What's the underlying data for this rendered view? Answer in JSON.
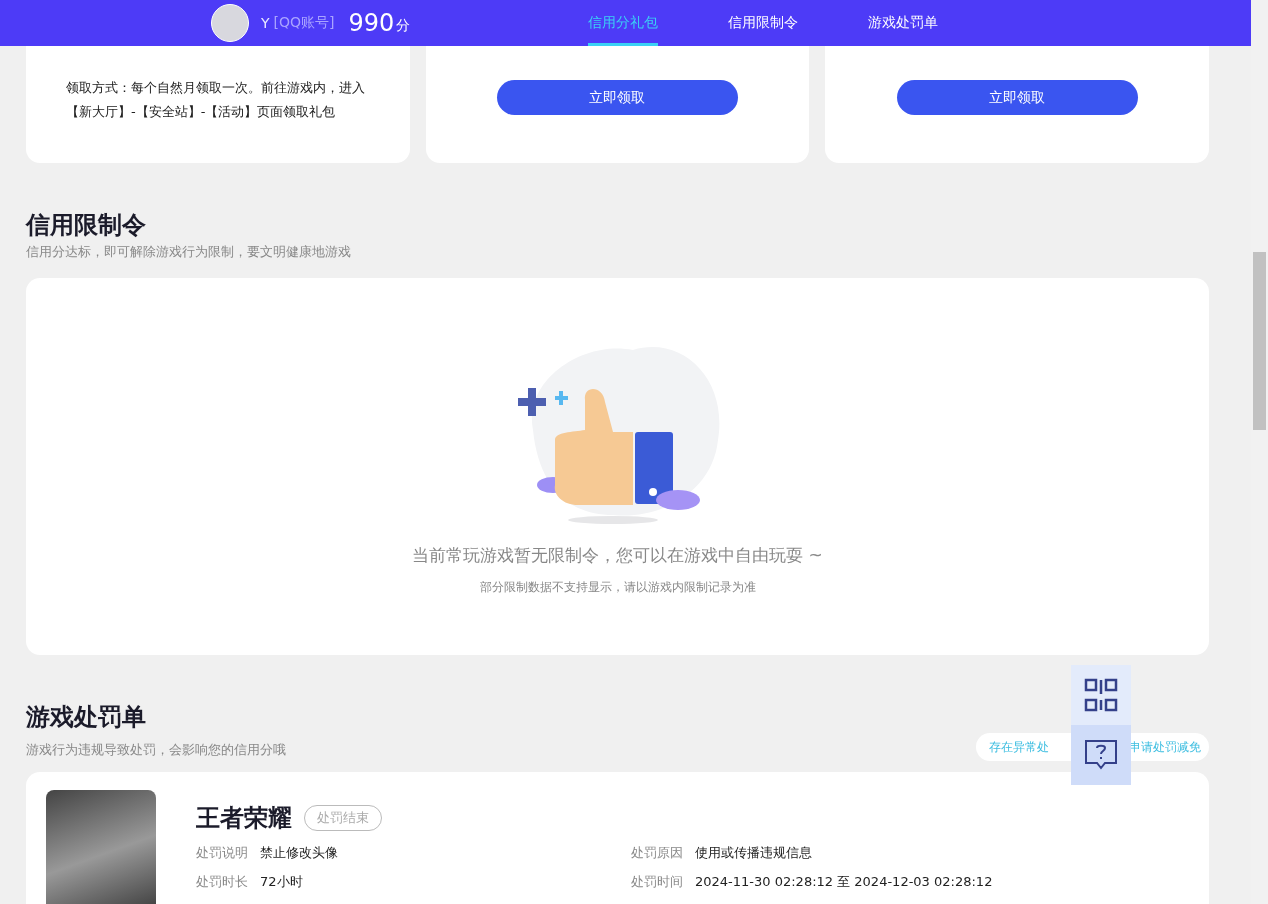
{
  "header": {
    "user_name": "Y",
    "account_type": "[QQ账号]",
    "score": "990",
    "score_unit": "分",
    "tabs": [
      {
        "label": "信用分礼包",
        "selected": true
      },
      {
        "label": "信用限制令",
        "selected": false
      },
      {
        "label": "游戏处罚单",
        "selected": false
      }
    ]
  },
  "gift_cards": [
    {
      "kind": "text",
      "text": "领取方式：每个自然月领取一次。前往游戏内，进入【新大厅】-【安全站】-【活动】页面领取礼包"
    },
    {
      "kind": "button",
      "button": "立即领取"
    },
    {
      "kind": "button",
      "button": "立即领取"
    }
  ],
  "restriction": {
    "title": "信用限制令",
    "subtitle": "信用分达标，即可解除游戏行为限制，要文明健康地游戏",
    "empty_message": "当前常玩游戏暂无限制令，您可以在游戏中自由玩耍 ~",
    "empty_note": "部分限制数据不支持显示，请以游戏内限制记录为准"
  },
  "penalties": {
    "title": "游戏处罚单",
    "subtitle": "游戏行为违规导致处罚，会影响您的信用分哦",
    "appeal_link": [
      "存在异常处",
      "申请处罚减免"
    ],
    "items": [
      {
        "game": "王者荣耀",
        "status": "处罚结束",
        "fields": [
          {
            "label": "处罚说明",
            "value": "禁止修改头像"
          },
          {
            "label": "处罚原因",
            "value": "使用或传播违规信息"
          },
          {
            "label": "处罚时长",
            "value": "72小时"
          },
          {
            "label": "处罚时间",
            "value": "2024-11-30 02:28:12 至 2024-12-03 02:28:12"
          }
        ]
      }
    ]
  }
}
